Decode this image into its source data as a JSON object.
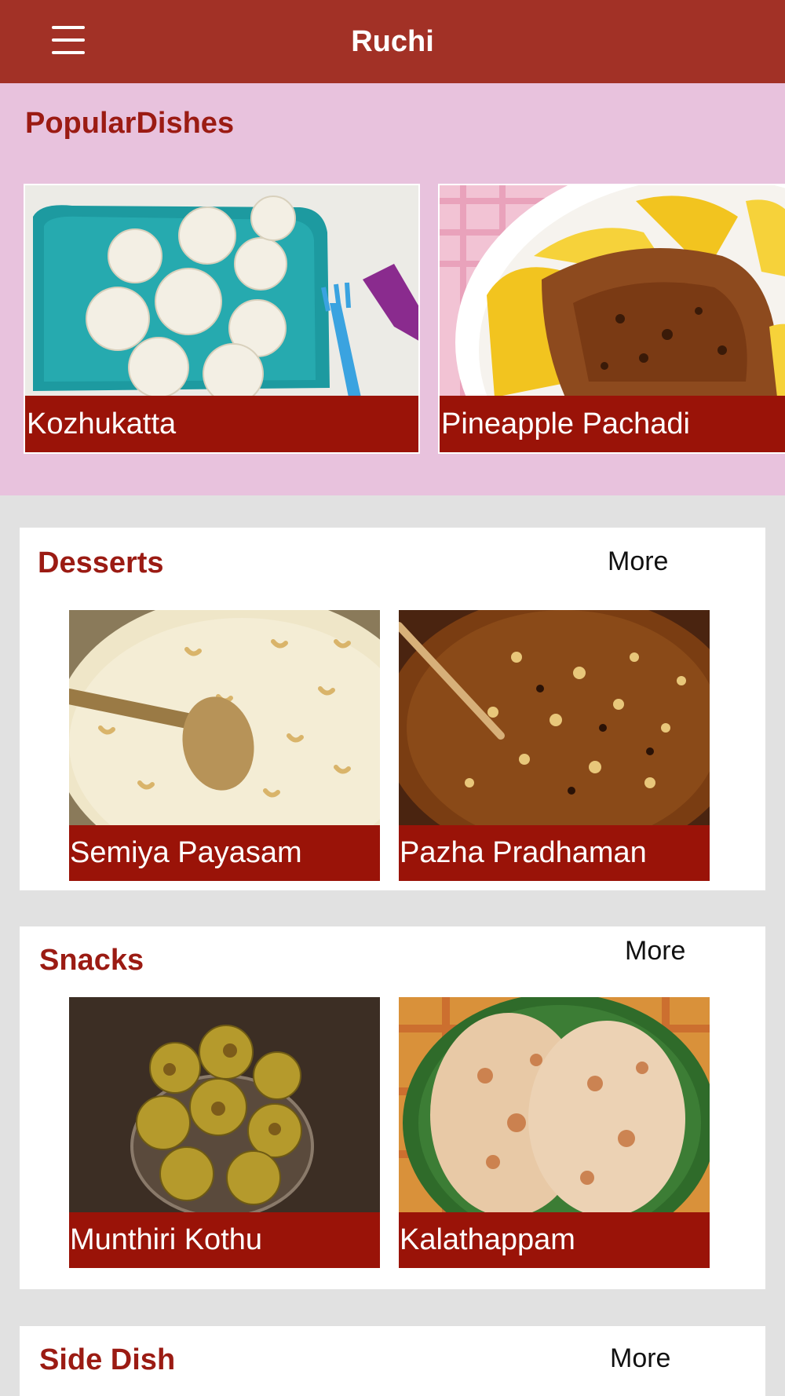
{
  "header": {
    "title": "Ruchi",
    "menu_icon": "hamburger-menu-icon"
  },
  "popular": {
    "title": "PopularDishes",
    "items": [
      {
        "name": "Kozhukatta"
      },
      {
        "name": "Pineapple Pachadi"
      }
    ]
  },
  "categories": [
    {
      "title": "Desserts",
      "more_label": "More",
      "items": [
        {
          "name": "Semiya Payasam"
        },
        {
          "name": "Pazha Pradhaman"
        }
      ]
    },
    {
      "title": "Snacks",
      "more_label": "More",
      "items": [
        {
          "name": "Munthiri Kothu"
        },
        {
          "name": "Kalathappam"
        }
      ]
    },
    {
      "title": "Side Dish",
      "more_label": "More",
      "items": []
    }
  ],
  "colors": {
    "header_bg": "#a23126",
    "popular_bg": "#e8c2dd",
    "accent_text": "#9b1b13",
    "label_bg": "#9a1308",
    "page_bg": "#e1e1e1"
  }
}
